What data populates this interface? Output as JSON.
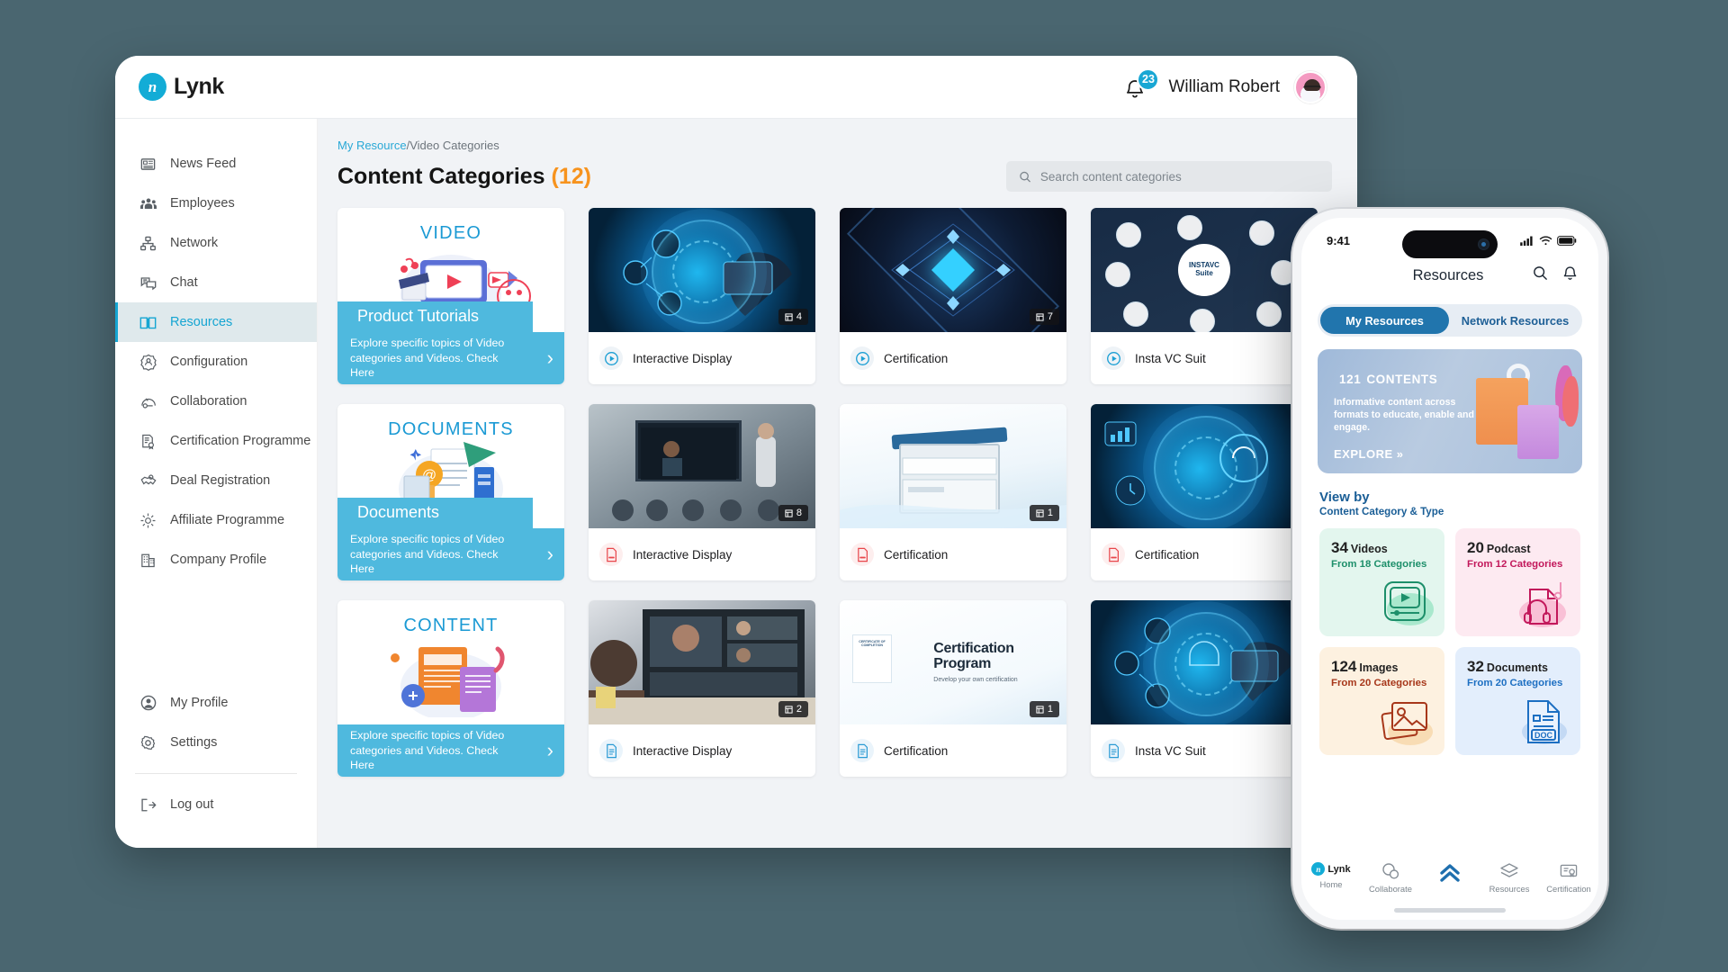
{
  "desktop": {
    "brand": {
      "mark": "n",
      "name": "Lynk"
    },
    "header": {
      "notification_count": "23",
      "user_name": "William Robert",
      "bell_icon": "bell-icon",
      "avatar_icon": "user-avatar"
    },
    "sidebar": {
      "items": [
        {
          "label": "News Feed",
          "icon": "newspaper-icon",
          "active": false
        },
        {
          "label": "Employees",
          "icon": "people-group-icon",
          "active": false
        },
        {
          "label": "Network",
          "icon": "network-nodes-icon",
          "active": false
        },
        {
          "label": "Chat",
          "icon": "chat-bubbles-icon",
          "active": false
        },
        {
          "label": "Resources",
          "icon": "open-book-icon",
          "active": true
        },
        {
          "label": "Configuration",
          "icon": "gear-people-icon",
          "active": false
        },
        {
          "label": "Collaboration",
          "icon": "handshake-dome-icon",
          "active": false
        },
        {
          "label": "Certification Programme",
          "icon": "certificate-icon",
          "active": false
        },
        {
          "label": "Deal Registration",
          "icon": "handshake-icon",
          "active": false
        },
        {
          "label": "Affiliate Programme",
          "icon": "affiliate-sun-icon",
          "active": false
        },
        {
          "label": "Company Profile",
          "icon": "building-icon",
          "active": false
        }
      ],
      "bottom_items": [
        {
          "label": "My Profile",
          "icon": "person-circle-icon"
        },
        {
          "label": "Settings",
          "icon": "gear-icon"
        }
      ],
      "logout": {
        "label": "Log out",
        "icon": "logout-icon"
      }
    },
    "breadcrumb": {
      "link": "My Resource",
      "separator": "/",
      "current": "Video Categories"
    },
    "page_title": "Content Categories",
    "page_title_count": "(12)",
    "search": {
      "placeholder": "Search content categories",
      "value": "",
      "icon": "search-icon"
    },
    "promos": [
      {
        "kicker": "VIDEO",
        "band": "Product Tutorials",
        "desc": "Explore specific topics of Video categories and Videos. Check Here",
        "chevron": "›",
        "art": "video-illustration"
      },
      {
        "kicker": "DOCUMENTS",
        "band": "Documents",
        "desc": "Explore specific topics of Video categories and Videos. Check Here",
        "chevron": "›",
        "art": "documents-illustration"
      },
      {
        "kicker": "CONTENT",
        "band": "",
        "desc": "Explore specific topics of Video categories and Videos. Check Here",
        "chevron": "›",
        "art": "content-illustration"
      }
    ],
    "cards": [
      {
        "title": "Interactive Display",
        "count": "4",
        "type": "video",
        "type_icon": "play-circle-icon",
        "thumb": "tech-hand-tablet"
      },
      {
        "title": "Certification",
        "count": "7",
        "type": "video",
        "type_icon": "play-circle-icon",
        "thumb": "dark-diamond-network"
      },
      {
        "title": "Insta VC Suit",
        "count": "",
        "type": "video",
        "type_icon": "play-circle-icon",
        "thumb": "insta-vc-network"
      },
      {
        "title": "Interactive Display",
        "count": "8",
        "type": "pdf",
        "type_icon": "pdf-file-icon",
        "thumb": "classroom-presentation"
      },
      {
        "title": "Certification",
        "count": "1",
        "type": "pdf",
        "type_icon": "pdf-file-icon",
        "thumb": "printer-device"
      },
      {
        "title": "Certification",
        "count": "",
        "type": "pdf",
        "type_icon": "pdf-file-icon",
        "thumb": "tech-dashboard"
      },
      {
        "title": "Interactive Display",
        "count": "2",
        "type": "doc",
        "type_icon": "doc-file-icon",
        "thumb": "video-meeting"
      },
      {
        "title": "Certification",
        "count": "1",
        "type": "doc",
        "type_icon": "doc-file-icon",
        "thumb": "certificate-program"
      },
      {
        "title": "Insta VC Suit",
        "count": "",
        "type": "doc",
        "type_icon": "doc-file-icon",
        "thumb": "tech-hand-tablet-2"
      }
    ],
    "certificate_thumb": {
      "title_line1": "Certification",
      "title_line2": "Program",
      "subtitle": "Develop your own certification",
      "seal_text": "CERTIFICATE OF COMPLETION"
    },
    "insta_thumb": {
      "center_line1": "INSTAVC",
      "center_line2": "Suite"
    }
  },
  "phone": {
    "status": {
      "time": "9:41",
      "signal_icon": "cellular-icon",
      "wifi_icon": "wifi-icon",
      "battery_icon": "battery-icon"
    },
    "title": "Resources",
    "actions": [
      {
        "icon": "search-icon",
        "name": "search"
      },
      {
        "icon": "bell-icon",
        "name": "notifications"
      }
    ],
    "segments": [
      {
        "label": "My Resources",
        "active": true
      },
      {
        "label": "Network Resources",
        "active": false
      }
    ],
    "hero": {
      "number": "121",
      "number_label": "CONTENTS",
      "description": "Informative content across formats to educate, enable and engage.",
      "cta": "EXPLORE »"
    },
    "viewby": {
      "title": "View by",
      "subtitle": "Content Category & Type"
    },
    "stats": [
      {
        "count": "34",
        "label": "Videos",
        "sub": "From 18 Categories",
        "theme": "green",
        "icon": "video-player-icon"
      },
      {
        "count": "20",
        "label": "Podcast",
        "sub": "From 12 Categories",
        "theme": "pink",
        "icon": "headphones-music-icon"
      },
      {
        "count": "124",
        "label": "Images",
        "sub": "From 20 Categories",
        "theme": "cream",
        "icon": "image-stack-icon"
      },
      {
        "count": "32",
        "label": "Documents",
        "sub": "From 20 Categories",
        "theme": "blue",
        "icon": "doc-file-icon"
      }
    ],
    "tabs": [
      {
        "label": "Home",
        "icon": "lynk-logo-icon",
        "active": false
      },
      {
        "label": "Collaborate",
        "icon": "chat-bubbles-icon",
        "active": false
      },
      {
        "label": "",
        "icon": "double-chevron-up-icon",
        "active": true
      },
      {
        "label": "Resources",
        "icon": "layers-icon",
        "active": false
      },
      {
        "label": "Certification",
        "icon": "certificate-icon",
        "active": false
      }
    ]
  },
  "colors": {
    "accent": "#15a5d2",
    "promo_band": "#4fb9de",
    "orange": "#f7931e",
    "page_bg": "#f1f3f6",
    "canvas_bg": "#4a6670",
    "phone_active": "#2175ad"
  }
}
